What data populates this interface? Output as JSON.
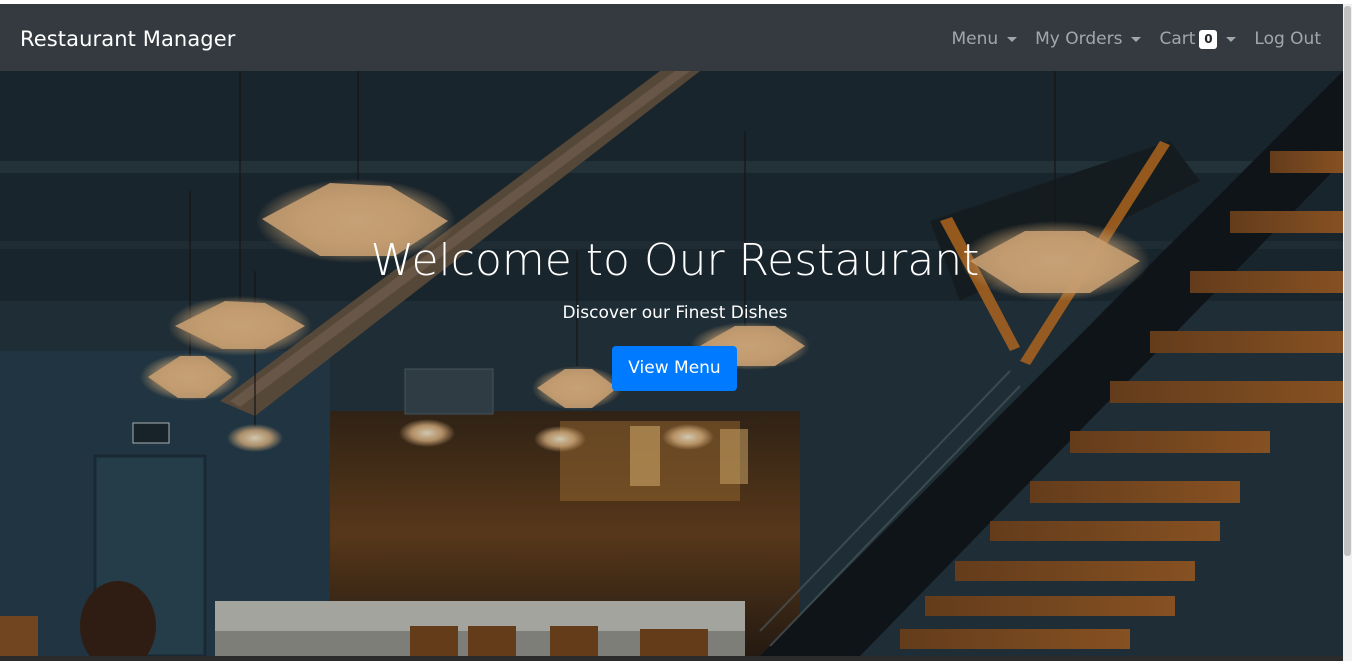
{
  "navbar": {
    "brand": "Restaurant Manager",
    "items": [
      {
        "label": "Menu",
        "dropdown": true
      },
      {
        "label": "My Orders",
        "dropdown": true
      },
      {
        "label": "Cart",
        "badge": "0",
        "dropdown": true
      },
      {
        "label": "Log Out",
        "dropdown": false
      }
    ]
  },
  "hero": {
    "title": "Welcome to Our Restaurant",
    "subtitle": "Discover our Finest Dishes",
    "cta_label": "View Menu",
    "background_icon": "restaurant-interior-photo"
  },
  "colors": {
    "navbar_bg": "#343a40",
    "primary": "#007bff",
    "nav_text": "rgba(255,255,255,0.55)"
  }
}
